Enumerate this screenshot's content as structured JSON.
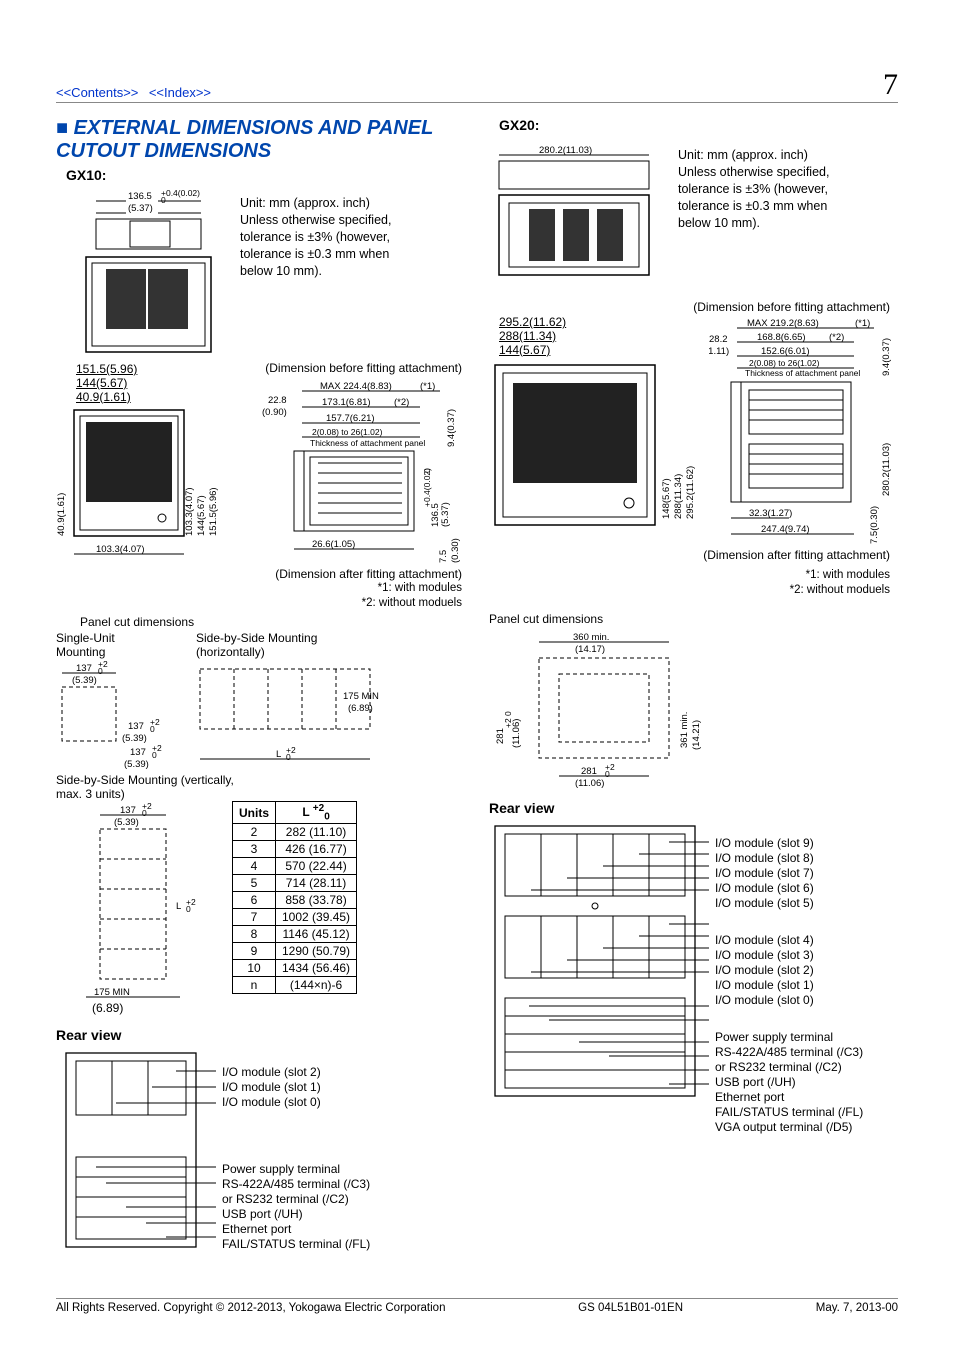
{
  "nav": {
    "contents": "<<Contents>>",
    "index": "<<Index>>"
  },
  "page_number": "7",
  "section_title": "External Dimensions and Panel Cutout Dimensions",
  "gx10": {
    "label": "GX10:",
    "unit_note": "Unit: mm (approx. inch) Unless otherwise specified, tolerance is ±3% (however, tolerance is ±0.3 mm when below 10 mm).",
    "top_dim": {
      "a": "136.5",
      "b": "(5.37)",
      "tol": "+0.4(0.02)",
      "tol2": "0"
    },
    "front_dims": {
      "a": "151.5(5.96)",
      "b": "144(5.67)",
      "c": "40.9(1.61)"
    },
    "left_dims": {
      "a": "40.9(1.61)",
      "b": "103.3(4.07)",
      "c": "144(5.67)",
      "d": "151.5(5.96)"
    },
    "bottom_dim": "103.3(4.07)",
    "right_top": {
      "a": "22.8",
      "b": "(0.90)"
    },
    "prof_before": "(Dimension before fitting attachment)",
    "prof_after": "(Dimension after fitting attachment)",
    "prof": {
      "max": "MAX 224.4(8.83)",
      "star1": "(*1)",
      "d1": "173.1(6.81)",
      "star2": "(*2)",
      "d2": "157.7(6.21)",
      "d3": "2(0.08) to 26(1.02)",
      "thick": "Thickness of attachment panel",
      "right": "9.4(0.37)",
      "right2a": "136.5",
      "right2b": "(5.37)",
      "right2tol": "+0.4(0.02)",
      "right2tol2": "0",
      "bot": "26.6(1.05)",
      "botr_a": "7.5",
      "botr_b": "(0.30)"
    },
    "notes": {
      "n1": "*1: with modules",
      "n2": "*2: without moduels"
    },
    "panel_cut_title": "Panel cut dimensions",
    "single": "Single-Unit Mounting",
    "side_h": "Side-by-Side Mounting (horizontally)",
    "side_v": "Side-by-Side Mounting (vertically, max. 3 units)",
    "cut_a": "137",
    "cut_b": "(5.39)",
    "cut_tol": "+2",
    "cut_tol2": "0",
    "h_min": "175 MIN",
    "h_min_in": "(6.89)",
    "L": "L",
    "L_tol": "+2",
    "L_tol2": "0",
    "v_min": "175 MIN",
    "v_min_in": "(6.89)",
    "rear_title": "Rear view",
    "rear_labels_top": [
      "I/O module (slot 2)",
      "I/O module (slot 1)",
      "I/O module (slot 0)"
    ],
    "rear_labels_bot": [
      "Power supply terminal",
      "RS-422A/485 terminal (/C3)",
      "or RS232 terminal (/C2)",
      "USB port (/UH)",
      "Ethernet port",
      "FAIL/STATUS terminal (/FL)"
    ]
  },
  "units_table": {
    "head": [
      "Units",
      "L"
    ],
    "rows": [
      [
        "2",
        "282 (11.10)"
      ],
      [
        "3",
        "426 (16.77)"
      ],
      [
        "4",
        "570 (22.44)"
      ],
      [
        "5",
        "714 (28.11)"
      ],
      [
        "6",
        "858 (33.78)"
      ],
      [
        "7",
        "1002 (39.45)"
      ],
      [
        "8",
        "1146 (45.12)"
      ],
      [
        "9",
        "1290 (50.79)"
      ],
      [
        "10",
        "1434 (56.46)"
      ],
      [
        "n",
        "(144×n)-6"
      ]
    ]
  },
  "gx20": {
    "label": "GX20:",
    "unit_note": "Unit: mm (approx. inch) Unless otherwise specified, tolerance is ±3% (however, tolerance is ±0.3 mm when below 10 mm).",
    "top": "280.2(11.03)",
    "front": {
      "a": "295.2(11.62)",
      "b": "288(11.34)",
      "c": "144(5.67)"
    },
    "right_top": {
      "a": "28.2",
      "b": "(1.11)"
    },
    "prof_before": "(Dimension before fitting attachment)",
    "prof_after": "(Dimension after fitting attachment)",
    "prof": {
      "max": "MAX 219.2(8.63)",
      "star1": "(*1)",
      "d1": "168.8(6.65)",
      "star2": "(*2)",
      "d2": "152.6(6.01)",
      "d3": "2(0.08) to 26(1.02)",
      "thick": "Thickness of attachment panel",
      "right": "9.4(0.37)",
      "right2": "280.2(11.03)",
      "bot": "32.3(1.27)",
      "bot2": "247.4(9.74)",
      "botr_a": "7.5",
      "botr_b": "(0.30)"
    },
    "left_dims": {
      "a": "148(5.67)",
      "b": "288(11.34)",
      "c": "295.2(11.62)"
    },
    "notes": {
      "n1": "*1: with modules",
      "n2": "*2: without moduels"
    },
    "panel_cut_title": "Panel cut dimensions",
    "cut": {
      "w": "360 min.",
      "w_in": "(14.17)",
      "h": "361 min.",
      "h_in": "(14.21)",
      "a": "281",
      "a_in": "(11.06)",
      "tol": "+2",
      "tol2": "0"
    },
    "rear_title": "Rear view",
    "rear_labels_top": [
      "I/O module (slot 9)",
      "I/O module (slot 8)",
      "I/O module (slot 7)",
      "I/O module (slot 6)",
      "I/O module (slot 5)"
    ],
    "rear_labels_mid": [
      "I/O module (slot 4)",
      "I/O module (slot 3)",
      "I/O module (slot 2)",
      "I/O module (slot 1)",
      "I/O module (slot 0)"
    ],
    "rear_labels_bot": [
      "Power supply terminal",
      "RS-422A/485 terminal (/C3)",
      "or RS232 terminal (/C2)",
      "USB port (/UH)",
      "Ethernet port",
      "FAIL/STATUS terminal (/FL)",
      "VGA output terminal (/D5)"
    ]
  },
  "footer": {
    "left": "All Rights Reserved. Copyright © 2012-2013, Yokogawa Electric Corporation",
    "mid": "GS 04L51B01-01EN",
    "right": "May. 7, 2013-00"
  }
}
